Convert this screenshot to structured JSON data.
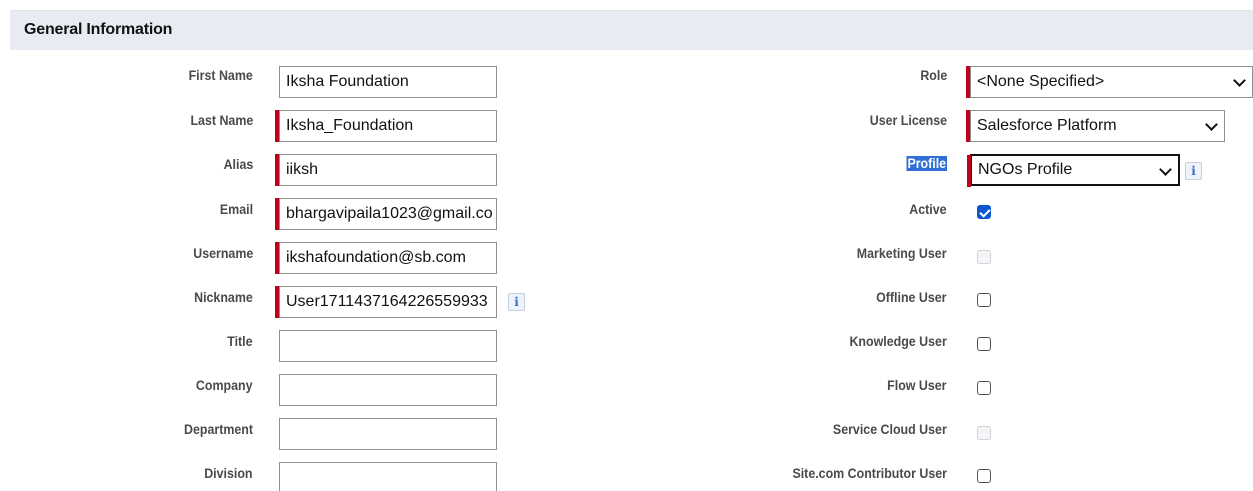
{
  "section": {
    "title": "General Information"
  },
  "left_fields": {
    "first_name": {
      "label": "First Name",
      "value": "Iksha Foundation"
    },
    "last_name": {
      "label": "Last Name",
      "value": "Iksha_Foundation"
    },
    "alias": {
      "label": "Alias",
      "value": "iiksh"
    },
    "email": {
      "label": "Email",
      "value": "bhargavipaila1023@gmail.co"
    },
    "username": {
      "label": "Username",
      "value": "ikshafoundation@sb.com"
    },
    "nickname": {
      "label": "Nickname",
      "value": "User1711437164226559933"
    },
    "title": {
      "label": "Title",
      "value": ""
    },
    "company": {
      "label": "Company",
      "value": ""
    },
    "department": {
      "label": "Department",
      "value": ""
    },
    "division": {
      "label": "Division",
      "value": ""
    }
  },
  "right_fields": {
    "role": {
      "label": "Role",
      "value": "<None Specified>"
    },
    "user_license": {
      "label": "User License",
      "value": "Salesforce Platform"
    },
    "profile": {
      "label": "Profile",
      "value": "NGOs Profile"
    },
    "active": {
      "label": "Active",
      "checked": true
    },
    "marketing_user": {
      "label": "Marketing User",
      "checked": false,
      "disabled": true
    },
    "offline_user": {
      "label": "Offline User",
      "checked": false
    },
    "knowledge_user": {
      "label": "Knowledge User",
      "checked": false
    },
    "flow_user": {
      "label": "Flow User",
      "checked": false
    },
    "service_cloud_user": {
      "label": "Service Cloud User",
      "checked": false,
      "disabled": true
    },
    "site_contributor_user": {
      "label": "Site.com Contributor User",
      "checked": false
    }
  },
  "icons": {
    "info": "i"
  },
  "colors": {
    "required": "#c2001d",
    "header_bg": "#e8ecf2",
    "checkbox_checked": "#0b57d0",
    "label_highlight": "#2f6fd6"
  }
}
